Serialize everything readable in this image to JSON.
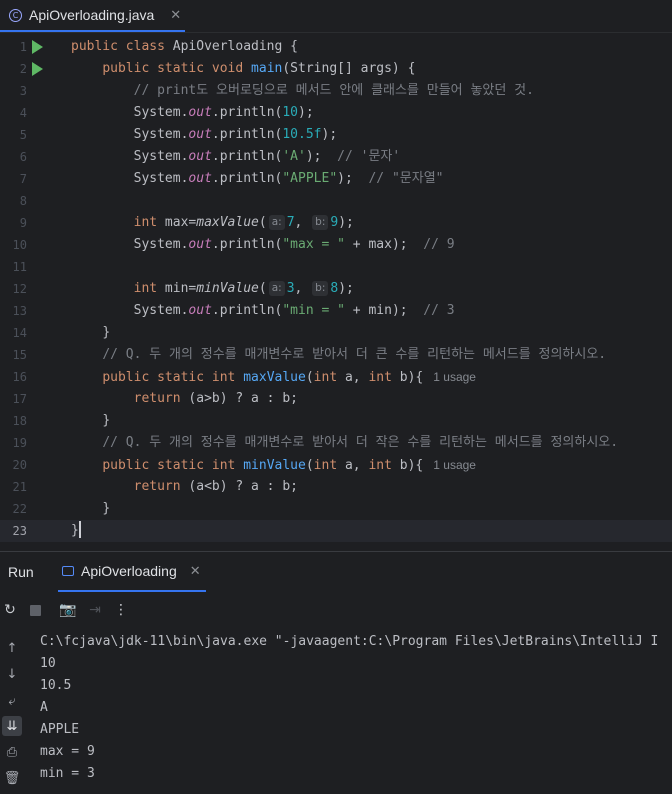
{
  "editor_tab": {
    "icon": "C",
    "title": "ApiOverloading.java",
    "close": "✕"
  },
  "line_numbers": [
    "1",
    "2",
    "3",
    "4",
    "5",
    "6",
    "7",
    "8",
    "9",
    "10",
    "11",
    "12",
    "13",
    "14",
    "15",
    "16",
    "17",
    "18",
    "19",
    "20",
    "21",
    "22",
    "23"
  ],
  "code": {
    "l1": {
      "kw1": "public",
      "kw2": "class",
      "cls": "ApiOverloading {"
    },
    "l2": {
      "kw1": "public",
      "kw2": "static",
      "kw3": "void",
      "name": "main",
      "rest": "(String[] args) {"
    },
    "l3": {
      "comment": "// print도 오버로딩으로 메서드 안에 클래스를 만들어 놓았던 것."
    },
    "l4": {
      "pre": "System.",
      "out": "out",
      "mid": ".println(",
      "arg": "10",
      "post": ");"
    },
    "l5": {
      "pre": "System.",
      "out": "out",
      "mid": ".println(",
      "arg": "10.5f",
      "post": ");"
    },
    "l6": {
      "pre": "System.",
      "out": "out",
      "mid": ".println(",
      "arg": "'A'",
      "post": ");  ",
      "comment": "// '문자'"
    },
    "l7": {
      "pre": "System.",
      "out": "out",
      "mid": ".println(",
      "arg": "\"APPLE\"",
      "post": ");  ",
      "comment": "// \"문자열\""
    },
    "l9": {
      "kw": "int",
      "decl": " max=",
      "call": "maxValue",
      "open": "(",
      "hint_a": "a:",
      "val_a": "7",
      "comma": ", ",
      "hint_b": "b:",
      "val_b": "9",
      "close": ");"
    },
    "l10": {
      "pre": "System.",
      "out": "out",
      "mid": ".println(",
      "arg": "\"max = \"",
      "post": " + max);  ",
      "comment": "// 9"
    },
    "l12": {
      "kw": "int",
      "decl": " min=",
      "call": "minValue",
      "open": "(",
      "hint_a": "a:",
      "val_a": "3",
      "comma": ", ",
      "hint_b": "b:",
      "val_b": "8",
      "close": ");"
    },
    "l13": {
      "pre": "System.",
      "out": "out",
      "mid": ".println(",
      "arg": "\"min = \"",
      "post": " + min);  ",
      "comment": "// 3"
    },
    "l14": {
      "text": "}"
    },
    "l15": {
      "comment": "// Q. 두 개의 정수를 매개변수로 받아서 더 큰 수를 리턴하는 메서드를 정의하시오."
    },
    "l16": {
      "kw1": "public",
      "kw2": "static",
      "kw3": "int",
      "name": "maxValue",
      "p1": "(",
      "kwa": "int",
      "pa": " a, ",
      "kwb": "int",
      "pb": " b){",
      "usage": "1 usage"
    },
    "l17": {
      "kw": "return",
      "rest": " (a>b) ? a : b;"
    },
    "l18": {
      "text": "}"
    },
    "l19": {
      "comment": "// Q. 두 개의 정수를 매개변수로 받아서 더 작은 수를 리턴하는 메서드를 정의하시오."
    },
    "l20": {
      "kw1": "public",
      "kw2": "static",
      "kw3": "int",
      "name": "minValue",
      "p1": "(",
      "kwa": "int",
      "pa": " a, ",
      "kwb": "int",
      "pb": " b){",
      "usage": "1 usage"
    },
    "l21": {
      "kw": "return",
      "rest": " (a<b) ? a : b;"
    },
    "l22": {
      "text": "}"
    },
    "l23": {
      "text": "}"
    }
  },
  "run_panel": {
    "label": "Run",
    "tab_title": "ApiOverloading",
    "tab_close": "✕"
  },
  "toolbar": {
    "rerun": "↻",
    "camera": "📷",
    "exit": "⇥",
    "more": "⋮"
  },
  "sidebar": {
    "up": "↑",
    "down": "↓",
    "wrap": "⤶",
    "scroll_end": "⇊",
    "print": "⎙",
    "trash": "🗑"
  },
  "console_lines": [
    "C:\\fcjava\\jdk-11\\bin\\java.exe \"-javaagent:C:\\Program Files\\JetBrains\\IntelliJ I",
    "10",
    "10.5",
    "A",
    "APPLE",
    "max = 9",
    "min = 3"
  ],
  "colors": {
    "background": "#1e1f22",
    "keyword": "#cf8e6d",
    "function": "#56a8f5",
    "number": "#2aacb8",
    "string": "#6aab73",
    "comment": "#7a7e85",
    "static_field": "#c77dba",
    "accent": "#3574f0"
  }
}
